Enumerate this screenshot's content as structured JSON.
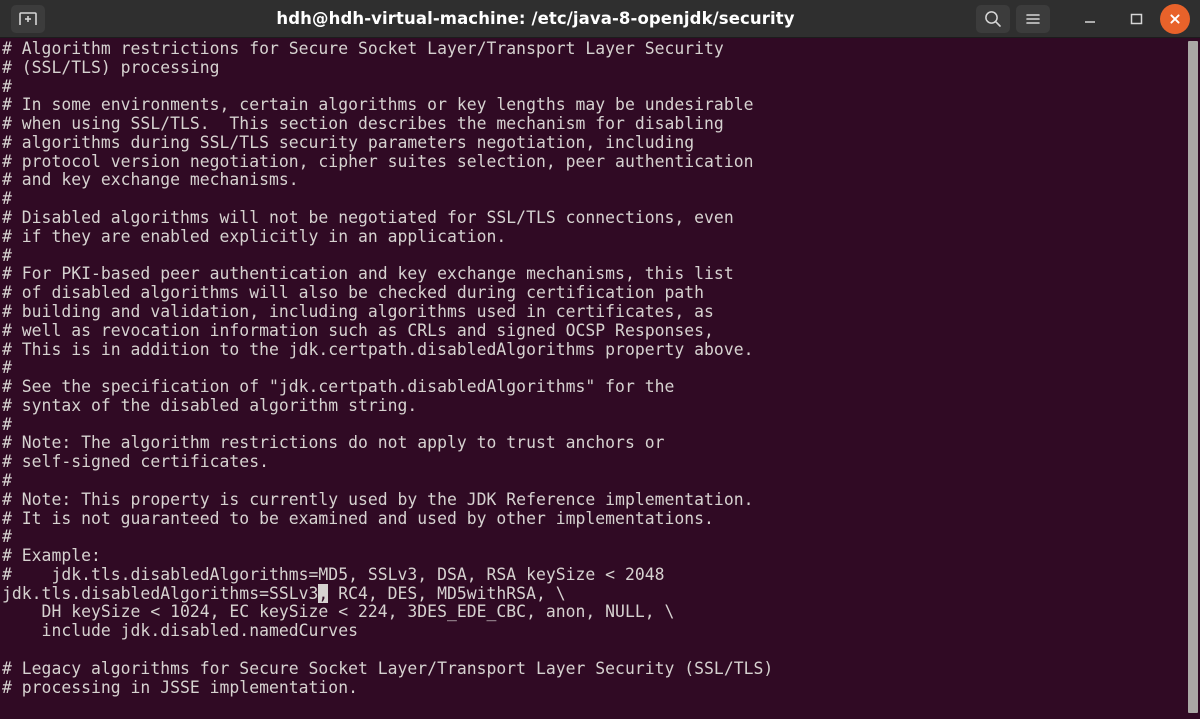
{
  "window": {
    "title": "hdh@hdh-virtual-machine: /etc/java-8-openjdk/security",
    "background_color": "#300a24",
    "text_color": "#d6d2d0",
    "titlebar_color": "#2f2f2f",
    "close_button_color": "#e8622a",
    "scrollbar_color": "#aaa8a5"
  },
  "titlebar": {
    "new_tab_icon": "new-tab-icon",
    "search_icon": "search-icon",
    "menu_icon": "hamburger-menu-icon",
    "minimize_icon": "minimize-icon",
    "maximize_icon": "maximize-icon",
    "close_icon": "close-icon"
  },
  "terminal": {
    "cursor": {
      "line_index": 29,
      "column": 32,
      "character": ",",
      "style": "block-inverted"
    },
    "lines": [
      "# Algorithm restrictions for Secure Socket Layer/Transport Layer Security",
      "# (SSL/TLS) processing",
      "#",
      "# In some environments, certain algorithms or key lengths may be undesirable",
      "# when using SSL/TLS.  This section describes the mechanism for disabling",
      "# algorithms during SSL/TLS security parameters negotiation, including",
      "# protocol version negotiation, cipher suites selection, peer authentication",
      "# and key exchange mechanisms.",
      "#",
      "# Disabled algorithms will not be negotiated for SSL/TLS connections, even",
      "# if they are enabled explicitly in an application.",
      "#",
      "# For PKI-based peer authentication and key exchange mechanisms, this list",
      "# of disabled algorithms will also be checked during certification path",
      "# building and validation, including algorithms used in certificates, as",
      "# well as revocation information such as CRLs and signed OCSP Responses,",
      "# This is in addition to the jdk.certpath.disabledAlgorithms property above.",
      "#",
      "# See the specification of \"jdk.certpath.disabledAlgorithms\" for the",
      "# syntax of the disabled algorithm string.",
      "#",
      "# Note: The algorithm restrictions do not apply to trust anchors or",
      "# self-signed certificates.",
      "#",
      "# Note: This property is currently used by the JDK Reference implementation.",
      "# It is not guaranteed to be examined and used by other implementations.",
      "#",
      "# Example:",
      "#    jdk.tls.disabledAlgorithms=MD5, SSLv3, DSA, RSA keySize < 2048",
      "jdk.tls.disabledAlgorithms=SSLv3, RC4, DES, MD5withRSA, \\",
      "    DH keySize < 1024, EC keySize < 224, 3DES_EDE_CBC, anon, NULL, \\",
      "    include jdk.disabled.namedCurves",
      "",
      "# Legacy algorithms for Secure Socket Layer/Transport Layer Security (SSL/TLS)",
      "# processing in JSSE implementation."
    ]
  }
}
